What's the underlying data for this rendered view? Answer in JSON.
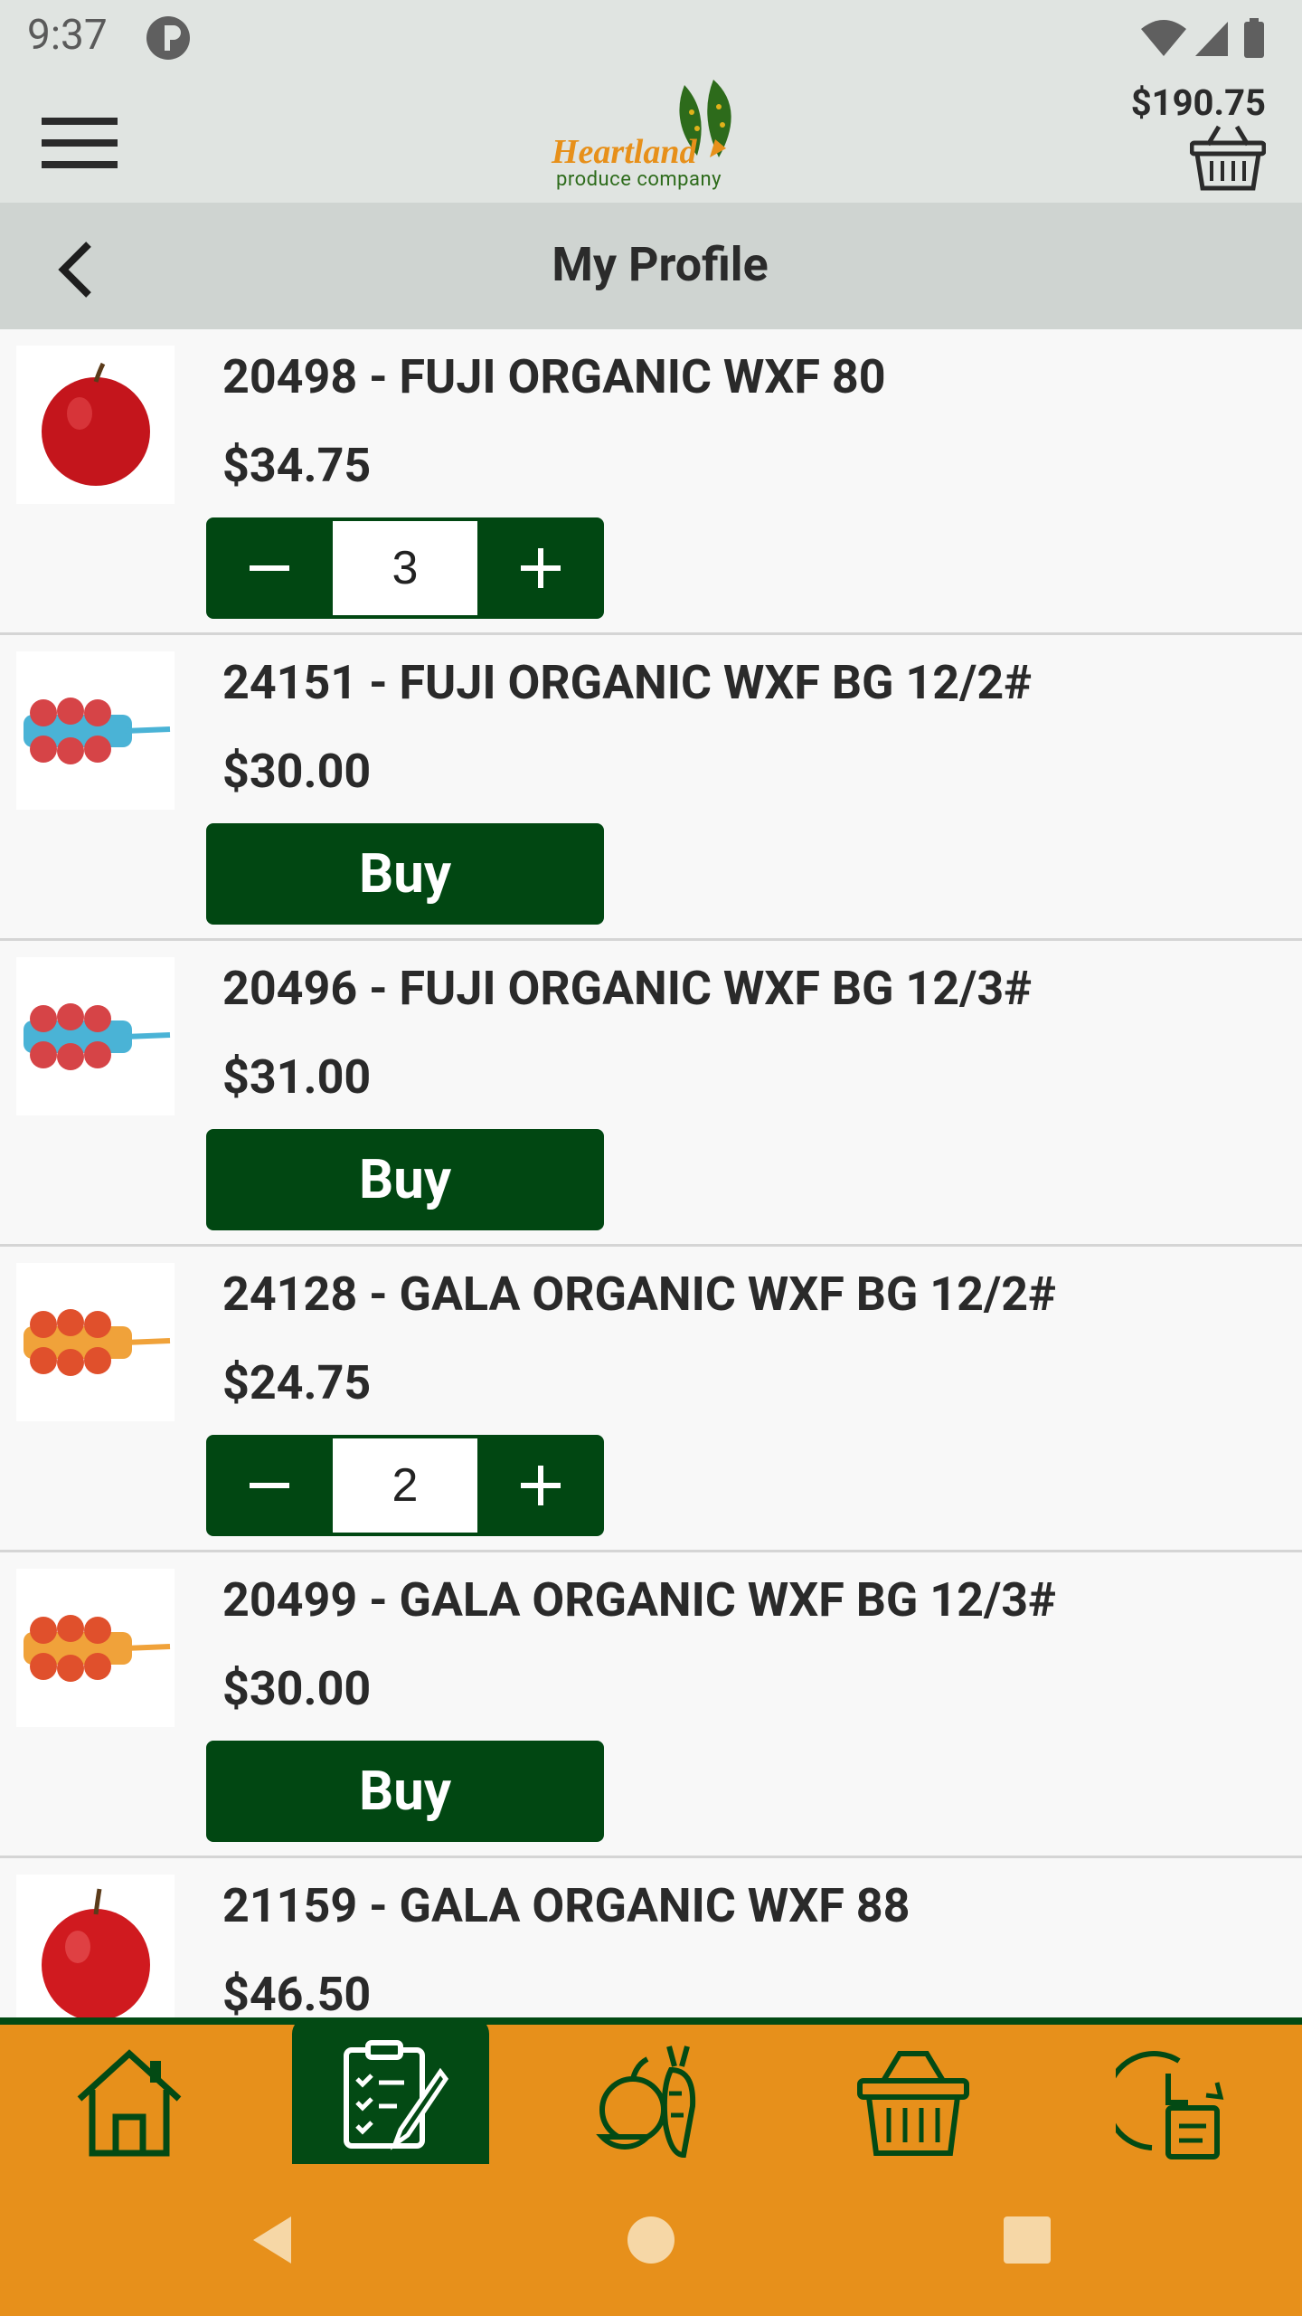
{
  "status_bar": {
    "time": "9:37"
  },
  "header": {
    "logo_text": "Heartland",
    "logo_subtext": "produce company",
    "cart_total": "$190.75"
  },
  "title_bar": {
    "title": "My Profile"
  },
  "products": [
    {
      "name": "20498 - FUJI ORGANIC WXF 80",
      "price": "$34.75",
      "quantity": "3",
      "thumb": "apple-icon",
      "action": "stepper"
    },
    {
      "name": "24151 - FUJI ORGANIC WXF BG 12/2#",
      "price": "$30.00",
      "buy_label": "Buy",
      "thumb": "apple-bag-icon",
      "action": "buy"
    },
    {
      "name": "20496 - FUJI ORGANIC WXF BG 12/3#",
      "price": "$31.00",
      "buy_label": "Buy",
      "thumb": "apple-bag-icon",
      "action": "buy"
    },
    {
      "name": "24128 - GALA ORGANIC WXF BG 12/2#",
      "price": "$24.75",
      "quantity": "2",
      "thumb": "apple-bag-icon",
      "action": "stepper"
    },
    {
      "name": "20499 - GALA ORGANIC WXF BG 12/3#",
      "price": "$30.00",
      "buy_label": "Buy",
      "thumb": "apple-bag-icon",
      "action": "buy"
    },
    {
      "name": "21159 - GALA ORGANIC WXF 88",
      "price": "$46.50",
      "thumb": "apple-icon",
      "action": "none"
    }
  ],
  "bottom_nav": [
    "home-icon",
    "order-list-icon",
    "produce-icon",
    "basket-icon",
    "order-history-icon"
  ],
  "colors": {
    "primary_green": "#014712",
    "accent_orange": "#e7901b",
    "header_bg": "#e0e4e1",
    "title_bar_bg": "#cfd4d1"
  }
}
